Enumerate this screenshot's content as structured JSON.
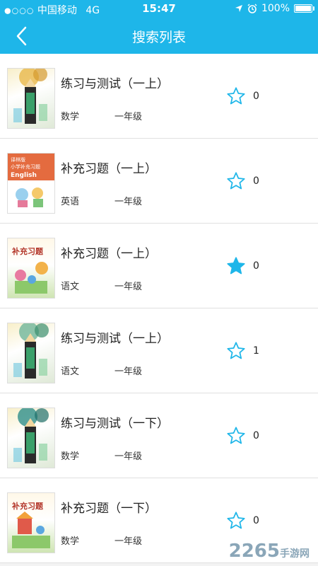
{
  "status": {
    "carrier": "中国移动",
    "network": "4G",
    "time": "15:47",
    "battery": "100%",
    "signal_dots": "●○○○"
  },
  "nav": {
    "title": "搜索列表"
  },
  "items": [
    {
      "title": "练习与测试（一上）",
      "subject": "数学",
      "grade": "一年级",
      "count": "0",
      "starred": false
    },
    {
      "title": "补充习题（一上）",
      "subject": "英语",
      "grade": "一年级",
      "count": "0",
      "starred": false
    },
    {
      "title": "补充习题（一上）",
      "subject": "语文",
      "grade": "一年级",
      "count": "0",
      "starred": true
    },
    {
      "title": "练习与测试（一上）",
      "subject": "语文",
      "grade": "一年级",
      "count": "1",
      "starred": false
    },
    {
      "title": "练习与测试（一下）",
      "subject": "数学",
      "grade": "一年级",
      "count": "0",
      "starred": false
    },
    {
      "title": "补充习题（一下）",
      "subject": "数学",
      "grade": "一年级",
      "count": "0",
      "starred": false
    }
  ],
  "cover_text": {
    "english_line1": "译林版",
    "english_line2": "小学补充习题",
    "english_word": "English",
    "chinese_word": "补充习题"
  },
  "watermark": {
    "brand": "2265",
    "suffix": "手游网"
  },
  "colors": {
    "header": "#1eb6e9",
    "star": "#1eb6e9"
  }
}
